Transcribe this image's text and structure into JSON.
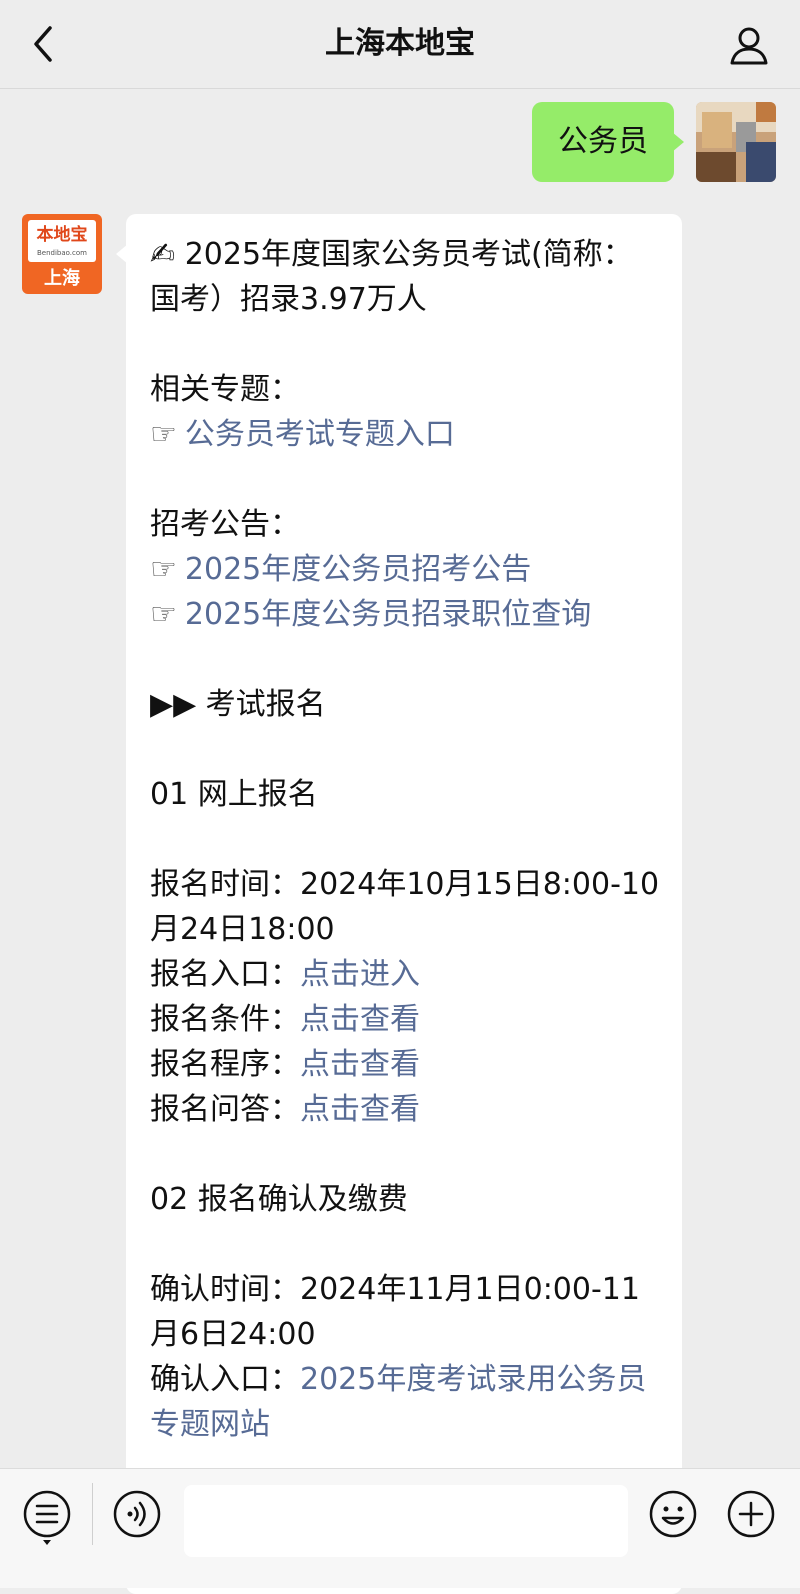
{
  "header": {
    "title": "上海本地宝",
    "back_icon": "chevron-left-icon",
    "profile_icon": "person-icon"
  },
  "sent_message": {
    "text": "公务员"
  },
  "bot_avatar": {
    "logo_text": "本地宝",
    "logo_sub": "Bendibao.com",
    "city": "上海"
  },
  "received_message": {
    "title_icon": "✍",
    "title": "2025年度国家公务员考试(简称：国考）招录3.97万人",
    "related_heading": "相关专题：",
    "related_link": "公务员考试专题入口",
    "notice_heading": "招考公告：",
    "notice_link_1": "2025年度公务员招考公告",
    "notice_link_2": "2025年度公务员招录职位查询",
    "section_heading": "▶▶ 考试报名",
    "step1_heading": "01 网上报名",
    "step1_time": "报名时间：2024年10月15日8:00-10月24日18:00",
    "step1_entry_label": "报名入口：",
    "step1_entry_link": "点击进入",
    "step1_cond_label": "报名条件：",
    "step1_cond_link": "点击查看",
    "step1_proc_label": "报名程序：",
    "step1_proc_link": "点击查看",
    "step1_qa_label": "报名问答：",
    "step1_qa_link": "点击查看",
    "step2_heading": "02 报名确认及缴费",
    "step2_time": "确认时间：2024年11月1日0:00-11月6日24:00",
    "step2_entry_label": "确认入口：",
    "step2_entry_link": "2025年度考试录用公务员专题网站",
    "pointer_glyph": "☞"
  },
  "input_bar": {
    "menu_icon": "menu-list-icon",
    "voice_icon": "voice-icon",
    "emoji_icon": "emoji-icon",
    "plus_icon": "plus-icon",
    "input_value": ""
  },
  "colors": {
    "link": "#576b95",
    "sent_bubble": "#95ec69",
    "background": "#ededed",
    "brand_orange": "#f06623"
  }
}
